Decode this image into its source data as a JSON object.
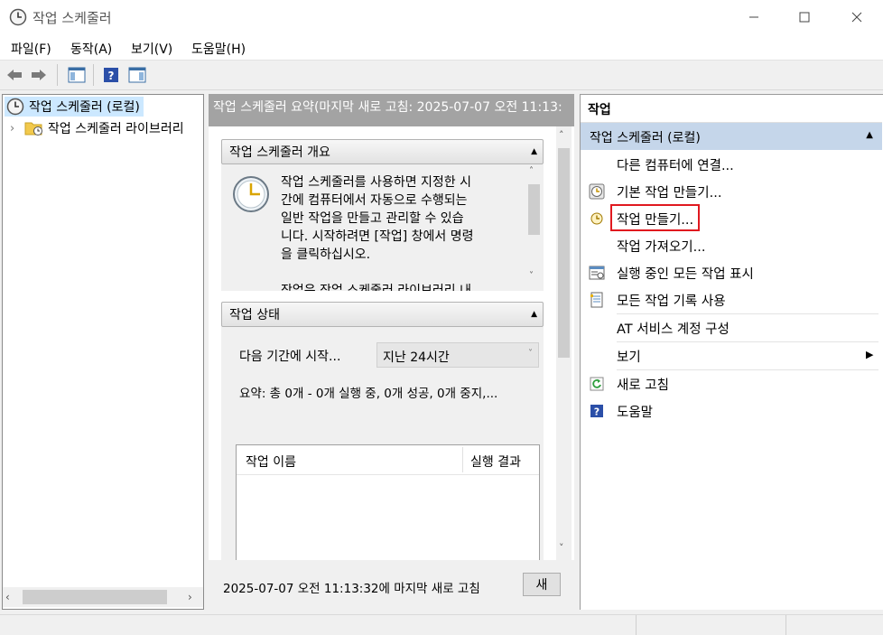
{
  "window": {
    "title": "작업 스케줄러",
    "minimize_icon": "minimize-icon",
    "maximize_icon": "maximize-icon",
    "close_icon": "close-icon"
  },
  "menu": {
    "items": [
      "파일(F)",
      "동작(A)",
      "보기(V)",
      "도움말(H)"
    ]
  },
  "toolbar": {
    "icons": [
      "back-arrow-icon",
      "forward-arrow-icon",
      "show-hide-console-tree-icon",
      "help-icon",
      "show-hide-action-pane-icon"
    ]
  },
  "tree": {
    "root": "작업 스케줄러 (로컬)",
    "child": "작업 스케줄러 라이브러리",
    "expander": "›"
  },
  "main": {
    "header": "작업 스케줄러 요약(마지막 새로 고침: 2025-07-07 오전 11:13:",
    "overview": {
      "title": "작업 스케줄러 개요",
      "lines": [
        "작업 스케줄러를 사용하면 지정한 시",
        "간에 컴퓨터에서 자동으로 수행되는",
        "일반 작업을 만들고 관리할 수 있습",
        "니다. 시작하려면 [작업] 창에서 명령",
        "을 클릭하십시오.",
        "",
        "작업은 작업 스케줄러 라이브러리 내"
      ]
    },
    "status": {
      "title": "작업 상태",
      "period_label": "다음 기간에 시작...",
      "period_value": "지난 24시간",
      "summary": "요약: 총 0개 - 0개 실행 중, 0개 성공, 0개 중지,...",
      "columns": [
        "작업 이름",
        "실행 결과"
      ]
    },
    "footer": {
      "last_refresh": "2025-07-07 오전 11:13:32에 마지막 새로 고침",
      "refresh_button": "새"
    }
  },
  "actions": {
    "header": "작업",
    "group": "작업 스케줄러 (로컬)",
    "items": [
      {
        "label": "다른 컴퓨터에 연결...",
        "icon": ""
      },
      {
        "label": "기본 작업 만들기...",
        "icon": "basic-task-wizard-icon"
      },
      {
        "label": "작업 만들기...",
        "icon": "create-task-icon",
        "highlighted": true
      },
      {
        "label": "작업 가져오기...",
        "icon": ""
      },
      {
        "label": "실행 중인 모든 작업 표시",
        "icon": "running-tasks-icon"
      },
      {
        "label": "모든 작업 기록 사용",
        "icon": "task-history-icon"
      },
      {
        "label": "AT 서비스 계정 구성",
        "icon": ""
      },
      {
        "label": "보기",
        "icon": "",
        "submenu": true
      },
      {
        "label": "새로 고침",
        "icon": "refresh-icon"
      },
      {
        "label": "도움말",
        "icon": "help-icon"
      }
    ]
  },
  "colors": {
    "selection": "#cce8ff",
    "actions_group_bg": "#c5d6ea",
    "header_gray": "#a3a3a3",
    "highlight_border": "#e0191f"
  }
}
